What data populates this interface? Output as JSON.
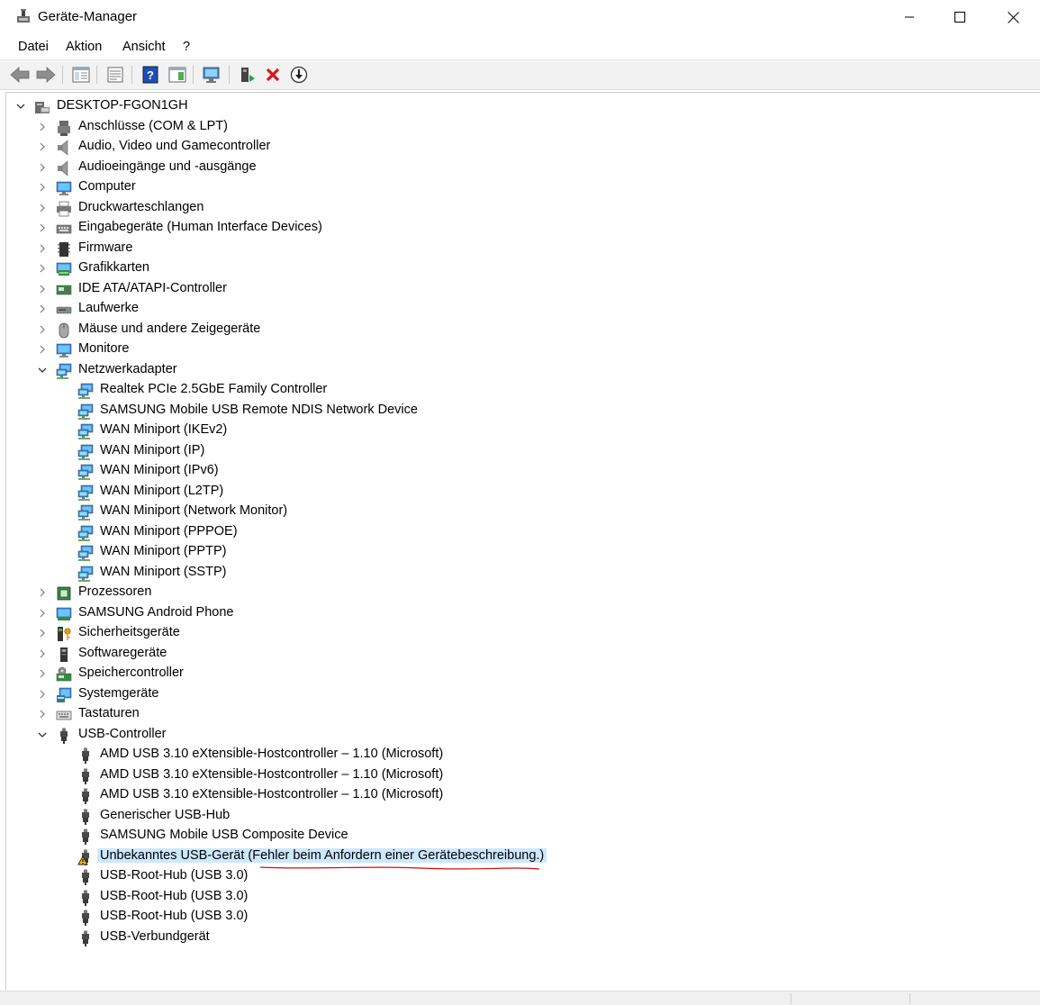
{
  "window": {
    "title": "Geräte-Manager"
  },
  "menu": [
    "Datei",
    "Aktion",
    "Ansicht",
    "?"
  ],
  "toolbar": [
    {
      "name": "back-button",
      "icon": "arrow-left-icon"
    },
    {
      "name": "forward-button",
      "icon": "arrow-right-icon"
    },
    {
      "name": "show-hide-console-tree-button",
      "icon": "console-tree-icon"
    },
    {
      "name": "properties-button",
      "icon": "properties-icon"
    },
    {
      "name": "help-button",
      "icon": "help-icon"
    },
    {
      "name": "view-button",
      "icon": "view-icon"
    },
    {
      "name": "scan-hardware-button",
      "icon": "monitor-scan-icon"
    },
    {
      "name": "update-driver-button",
      "icon": "update-driver-icon"
    },
    {
      "name": "uninstall-device-button",
      "icon": "red-x-icon"
    },
    {
      "name": "disable-device-button",
      "icon": "down-arrow-circle-icon"
    }
  ],
  "tree": {
    "root": "DESKTOP-FGON1GH",
    "categories": [
      {
        "label": "Anschlüsse (COM & LPT)",
        "icon": "port-icon",
        "expanded": false,
        "children": []
      },
      {
        "label": "Audio, Video und Gamecontroller",
        "icon": "speaker-icon",
        "expanded": false,
        "children": []
      },
      {
        "label": "Audioeingänge und -ausgänge",
        "icon": "speaker-icon",
        "expanded": false,
        "children": []
      },
      {
        "label": "Computer",
        "icon": "computer-icon",
        "expanded": false,
        "children": []
      },
      {
        "label": "Druckwarteschlangen",
        "icon": "printer-icon",
        "expanded": false,
        "children": []
      },
      {
        "label": "Eingabegeräte (Human Interface Devices)",
        "icon": "hid-icon",
        "expanded": false,
        "children": []
      },
      {
        "label": "Firmware",
        "icon": "firmware-icon",
        "expanded": false,
        "children": []
      },
      {
        "label": "Grafikkarten",
        "icon": "display-adapter-icon",
        "expanded": false,
        "children": []
      },
      {
        "label": "IDE ATA/ATAPI-Controller",
        "icon": "ide-controller-icon",
        "expanded": false,
        "children": []
      },
      {
        "label": "Laufwerke",
        "icon": "disk-drive-icon",
        "expanded": false,
        "children": []
      },
      {
        "label": "Mäuse und andere Zeigegeräte",
        "icon": "mouse-icon",
        "expanded": false,
        "children": []
      },
      {
        "label": "Monitore",
        "icon": "monitor-icon",
        "expanded": false,
        "children": []
      },
      {
        "label": "Netzwerkadapter",
        "icon": "network-adapter-icon",
        "expanded": true,
        "children": [
          {
            "label": "Realtek PCIe 2.5GbE Family Controller",
            "icon": "network-adapter-icon",
            "warning": false
          },
          {
            "label": "SAMSUNG Mobile USB Remote NDIS Network Device",
            "icon": "network-adapter-icon",
            "warning": false
          },
          {
            "label": "WAN Miniport (IKEv2)",
            "icon": "network-adapter-icon",
            "warning": false
          },
          {
            "label": "WAN Miniport (IP)",
            "icon": "network-adapter-icon",
            "warning": false
          },
          {
            "label": "WAN Miniport (IPv6)",
            "icon": "network-adapter-icon",
            "warning": false
          },
          {
            "label": "WAN Miniport (L2TP)",
            "icon": "network-adapter-icon",
            "warning": false
          },
          {
            "label": "WAN Miniport (Network Monitor)",
            "icon": "network-adapter-icon",
            "warning": false
          },
          {
            "label": "WAN Miniport (PPPOE)",
            "icon": "network-adapter-icon",
            "warning": false
          },
          {
            "label": "WAN Miniport (PPTP)",
            "icon": "network-adapter-icon",
            "warning": false
          },
          {
            "label": "WAN Miniport (SSTP)",
            "icon": "network-adapter-icon",
            "warning": false
          }
        ]
      },
      {
        "label": "Prozessoren",
        "icon": "processor-icon",
        "expanded": false,
        "children": []
      },
      {
        "label": "SAMSUNG Android Phone",
        "icon": "phone-icon",
        "expanded": false,
        "children": []
      },
      {
        "label": "Sicherheitsgeräte",
        "icon": "security-key-icon",
        "expanded": false,
        "children": []
      },
      {
        "label": "Softwaregeräte",
        "icon": "software-device-icon",
        "expanded": false,
        "children": []
      },
      {
        "label": "Speichercontroller",
        "icon": "storage-controller-icon",
        "expanded": false,
        "children": []
      },
      {
        "label": "Systemgeräte",
        "icon": "system-device-icon",
        "expanded": false,
        "children": []
      },
      {
        "label": "Tastaturen",
        "icon": "keyboard-icon",
        "expanded": false,
        "children": []
      },
      {
        "label": "USB-Controller",
        "icon": "usb-plug-icon",
        "expanded": true,
        "children": [
          {
            "label": "AMD USB 3.10 eXtensible-Hostcontroller – 1.10 (Microsoft)",
            "icon": "usb-plug-icon",
            "warning": false
          },
          {
            "label": "AMD USB 3.10 eXtensible-Hostcontroller – 1.10 (Microsoft)",
            "icon": "usb-plug-icon",
            "warning": false
          },
          {
            "label": "AMD USB 3.10 eXtensible-Hostcontroller – 1.10 (Microsoft)",
            "icon": "usb-plug-icon",
            "warning": false
          },
          {
            "label": "Generischer USB-Hub",
            "icon": "usb-plug-icon",
            "warning": false
          },
          {
            "label": "SAMSUNG Mobile USB Composite Device",
            "icon": "usb-plug-icon",
            "warning": false
          },
          {
            "label": "Unbekanntes USB-Gerät (Fehler beim Anfordern einer Gerätebeschreibung.)",
            "icon": "usb-plug-icon",
            "warning": true,
            "selected": true
          },
          {
            "label": "USB-Root-Hub (USB 3.0)",
            "icon": "usb-plug-icon",
            "warning": false
          },
          {
            "label": "USB-Root-Hub (USB 3.0)",
            "icon": "usb-plug-icon",
            "warning": false
          },
          {
            "label": "USB-Root-Hub (USB 3.0)",
            "icon": "usb-plug-icon",
            "warning": false
          },
          {
            "label": "USB-Verbundgerät",
            "icon": "usb-plug-icon",
            "warning": false
          }
        ]
      }
    ]
  },
  "colors": {
    "selection": "#cce8ff",
    "annotation": "#d01010",
    "accent": "#0078d7"
  }
}
